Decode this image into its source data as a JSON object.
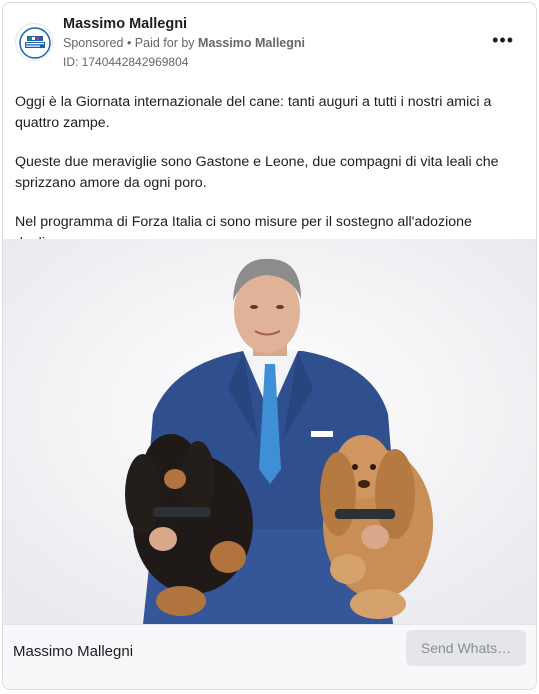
{
  "ad": {
    "page_name": "Massimo Mallegni",
    "sponsored_label": "Sponsored",
    "separator": " • ",
    "paid_for_prefix": "Paid for by ",
    "paid_for_name": "Massimo Mallegni",
    "ad_id": "ID: 1740442842969804",
    "more_icon": "more-options-icon",
    "avatar_icon": "forza-italia-logo"
  },
  "body": {
    "paragraphs": [
      "Oggi è la Giornata internazionale del cane: tanti auguri a tutti i nostri amici a quattro zampe.",
      "Queste due meraviglie sono Gastone e Leone, due compagni di vita leali che sprizzano amore da ogni poro.",
      "Nel programma di Forza Italia ci sono misure per il sostegno all'adozione degli…"
    ]
  },
  "footer": {
    "name": "Massimo Mallegni",
    "cta_label": "Send Whats…"
  },
  "colors": {
    "text": "#1c1e21",
    "secondary": "#65676b",
    "suit": "#2f4f8f",
    "tie": "#3f8fd6",
    "cta_bg": "#e4e6eb"
  }
}
